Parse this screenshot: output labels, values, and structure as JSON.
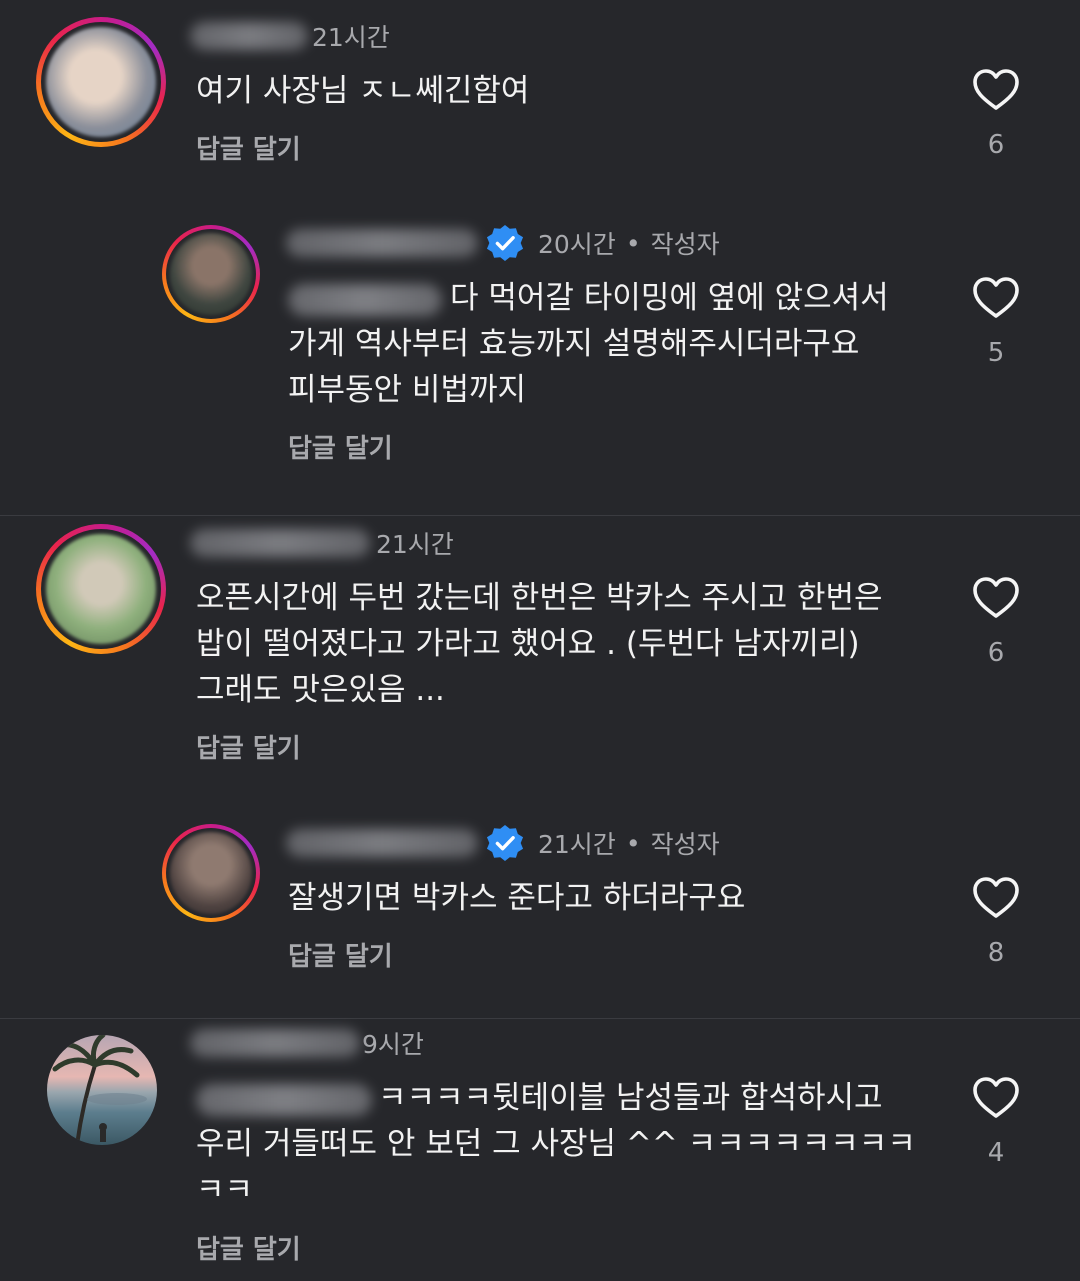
{
  "comments": [
    {
      "time": "21시간",
      "lines": [
        "여기  사장님 ㅈㄴ쎄긴함여"
      ],
      "reply_label": "답글 달기",
      "likes": "6",
      "avatar_colors": [
        "#d8c8bd",
        "#6b7a8d"
      ]
    },
    {
      "time": "20시간",
      "dot": "•",
      "author_tag": "작성자",
      "lines": [
        "다 먹어갈 타이밍에 옆에 앉으셔서",
        "가게 역사부터 효능까지 설명해주시더라구요",
        "피부동안 비법까지"
      ],
      "reply_label": "답글 달기",
      "likes": "5",
      "avatar_colors": [
        "#7a6a62",
        "#3b4a45"
      ]
    },
    {
      "time": "21시간",
      "lines": [
        "오픈시간에 두번 갔는데 한번은 박카스 주시고 한번은",
        "밥이 떨어졌다고 가라고 했어요 . (두번다 남자끼리)",
        "그래도 맛은있음 ..."
      ],
      "reply_label": "답글 달기",
      "likes": "6",
      "avatar_colors": [
        "#8fb07d",
        "#c9cbb8"
      ]
    },
    {
      "time": "21시간",
      "dot": "•",
      "author_tag": "작성자",
      "lines": [
        "잘생기면 박카스 준다고 하더라구요"
      ],
      "reply_label": "답글 달기",
      "likes": "8",
      "avatar_colors": [
        "#6e5b55",
        "#a89586"
      ]
    },
    {
      "time": "9시간",
      "lines": [
        "ㅋㅋㅋㅋ뒷테이블 남성들과 합석하시고",
        "우리 거들떠도 안 보던 그 사장님 ^^ ㅋㅋㅋㅋㅋㅋㅋㅋ",
        "ㅋㅋ"
      ],
      "reply_label": "답글 달기",
      "likes": "4",
      "avatar_colors": [
        "#d9a7a6",
        "#3f5d6b"
      ]
    }
  ],
  "colors": {
    "background": "#26272b",
    "verified": "#2f8ef4",
    "secondary_text": "#a8a9ad"
  },
  "icons": {
    "like": "heart-outline-icon",
    "verified": "verified-badge-icon"
  }
}
